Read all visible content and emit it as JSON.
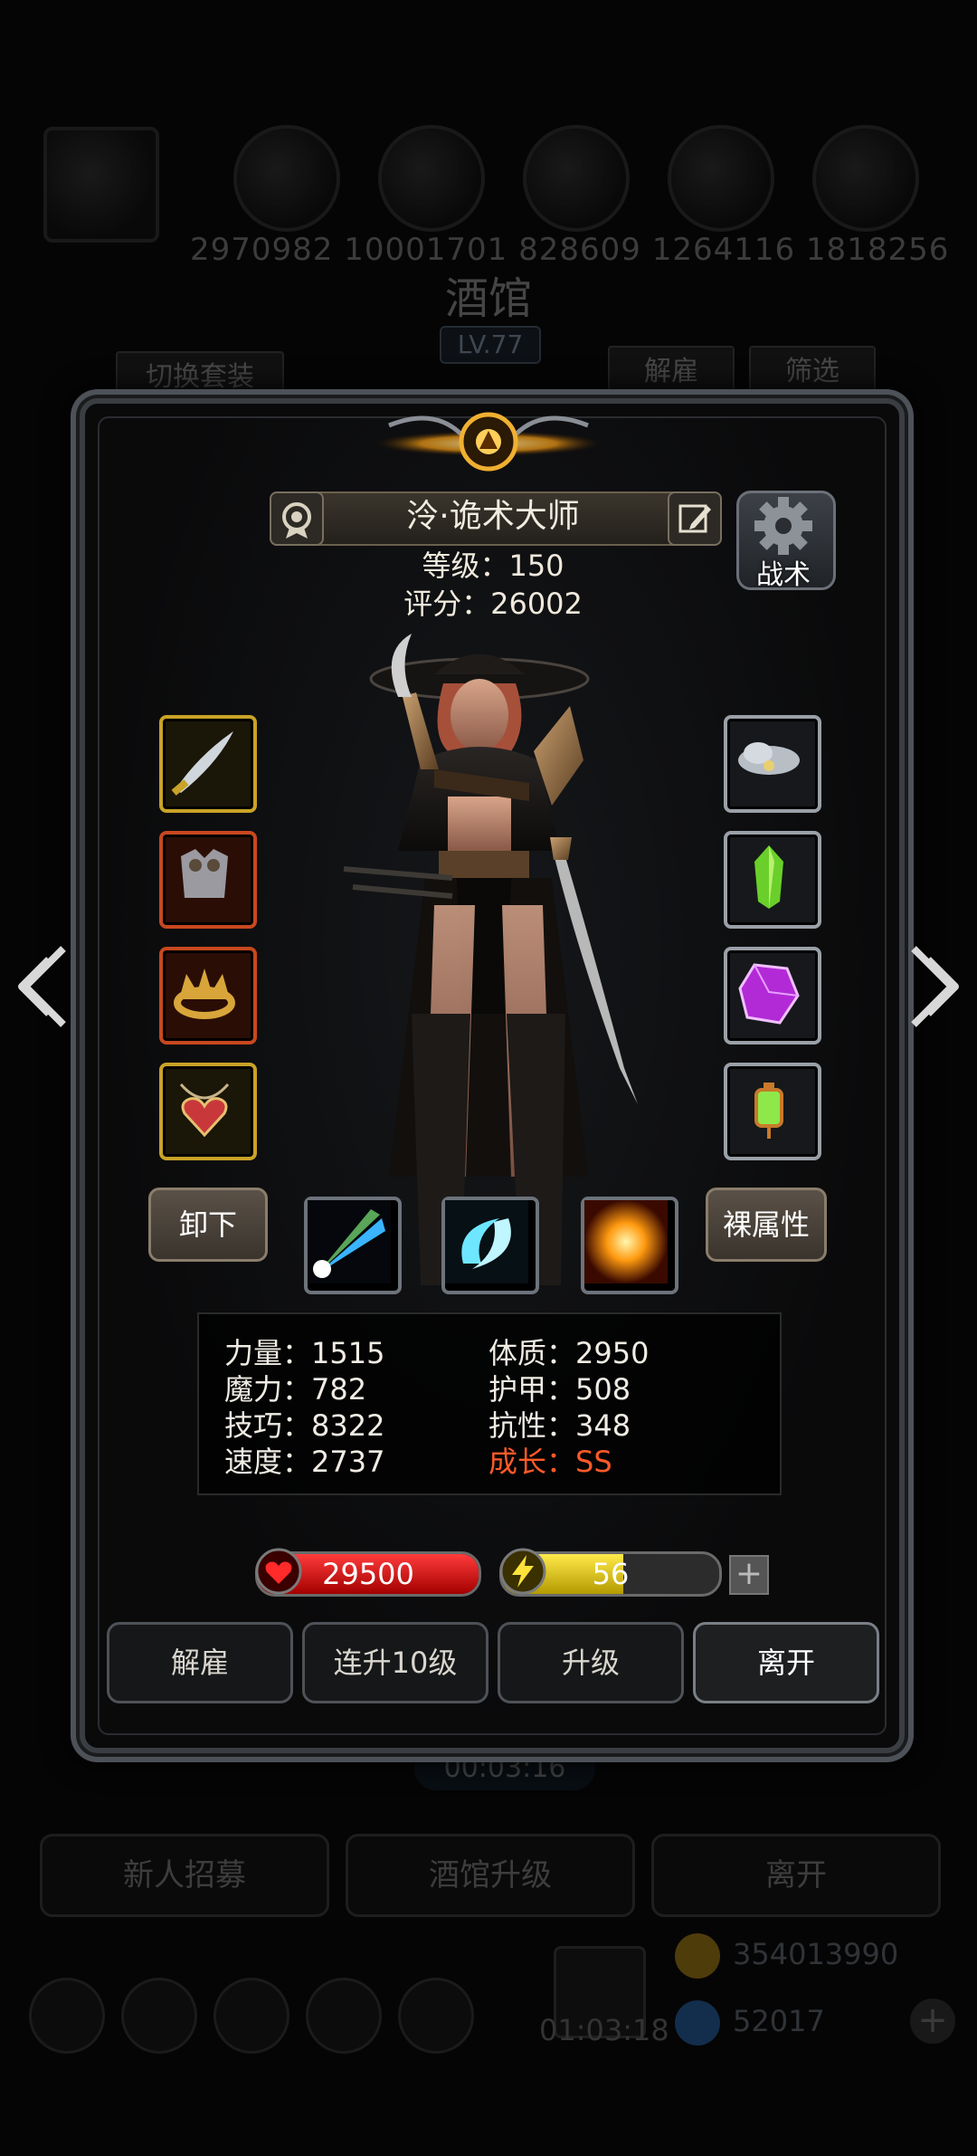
{
  "background": {
    "resources": "2970982  10001701  828609  1264116  1818256",
    "title": "酒馆",
    "level": "LV.77",
    "switch_outfit": "切换套装",
    "dismiss": "解雇",
    "filter": "筛选",
    "timer_top": "00:03:16",
    "recruit": "新人招募",
    "upgrade_tavern": "酒馆升级",
    "leave": "离开",
    "timer_bottom": "01:03:18",
    "gold": "354013990",
    "gems": "52017"
  },
  "hero": {
    "name": "泠·诡术大师",
    "level_label": "等级：150",
    "score_label": "评分：26002",
    "tactics": "战术"
  },
  "buttons": {
    "unequip": "卸下",
    "base_attributes": "裸属性",
    "dismiss": "解雇",
    "level10": "连升10级",
    "upgrade": "升级",
    "leave": "离开",
    "plus": "+"
  },
  "attributes": {
    "strength": "力量：1515",
    "magic": "魔力：782",
    "skill": "技巧：8322",
    "speed": "速度：2737",
    "constitution": "体质：2950",
    "armor": "护甲：508",
    "resistance": "抗性：348",
    "growth": "成长：SS"
  },
  "hp": {
    "value": "29500",
    "fill": 1.0
  },
  "energy": {
    "value": "56",
    "fill": 0.56
  },
  "colors": {
    "growth": "#ff5a28",
    "hp": "#e01f1f",
    "energy": "#f2d81e",
    "gold_frame": "#c9a227"
  }
}
